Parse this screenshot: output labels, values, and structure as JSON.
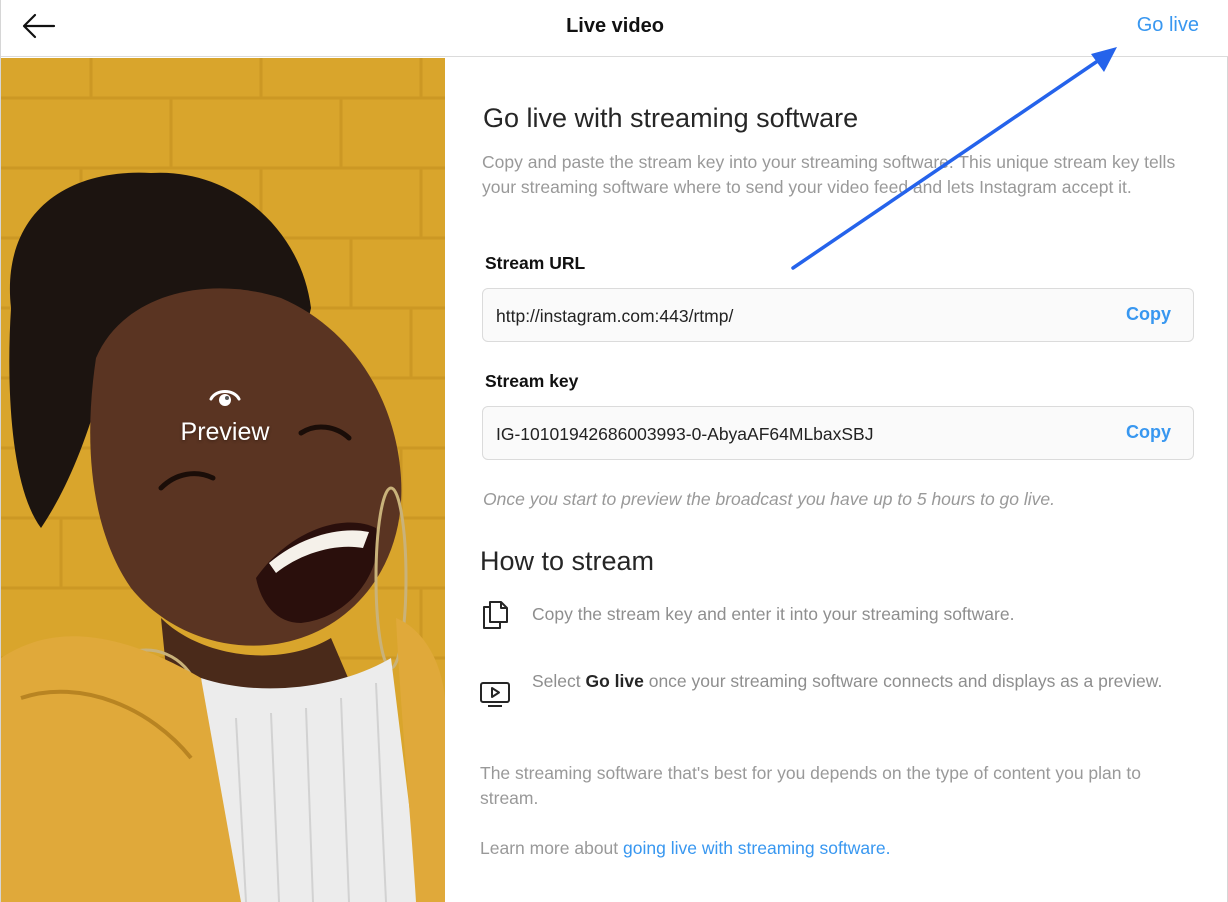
{
  "header": {
    "title": "Live video",
    "go_live_label": "Go live"
  },
  "preview": {
    "label": "Preview"
  },
  "main": {
    "heading": "Go live with streaming software",
    "description": "Copy and paste the stream key into your streaming software. This unique stream key tells your streaming software where to send your video feed and lets Instagram accept it.",
    "stream_url": {
      "label": "Stream URL",
      "value": "http://instagram.com:443/rtmp/",
      "copy_label": "Copy"
    },
    "stream_key": {
      "label": "Stream key",
      "value": "IG-10101942686003993-0-AbyaAF64MLbaxSBJ",
      "copy_label": "Copy"
    },
    "note": "Once you start to preview the broadcast you have up to 5 hours to go live."
  },
  "how_to": {
    "heading": "How to stream",
    "steps": [
      {
        "icon": "copy-icon",
        "text": "Copy the stream key and enter it into your streaming software."
      },
      {
        "icon": "video-screen-icon",
        "text_before": "Select ",
        "text_bold": "Go live",
        "text_after": " once your streaming software connects and displays as a preview."
      }
    ],
    "footer": "The streaming software that's best for you depends on the type of content you plan to stream.",
    "learn_more_prefix": "Learn more about ",
    "learn_more_link": "going live with streaming software."
  },
  "colors": {
    "accent": "#3897f0",
    "annotation_arrow": "#2563eb",
    "backdrop_yellow": "#d9a52c"
  }
}
